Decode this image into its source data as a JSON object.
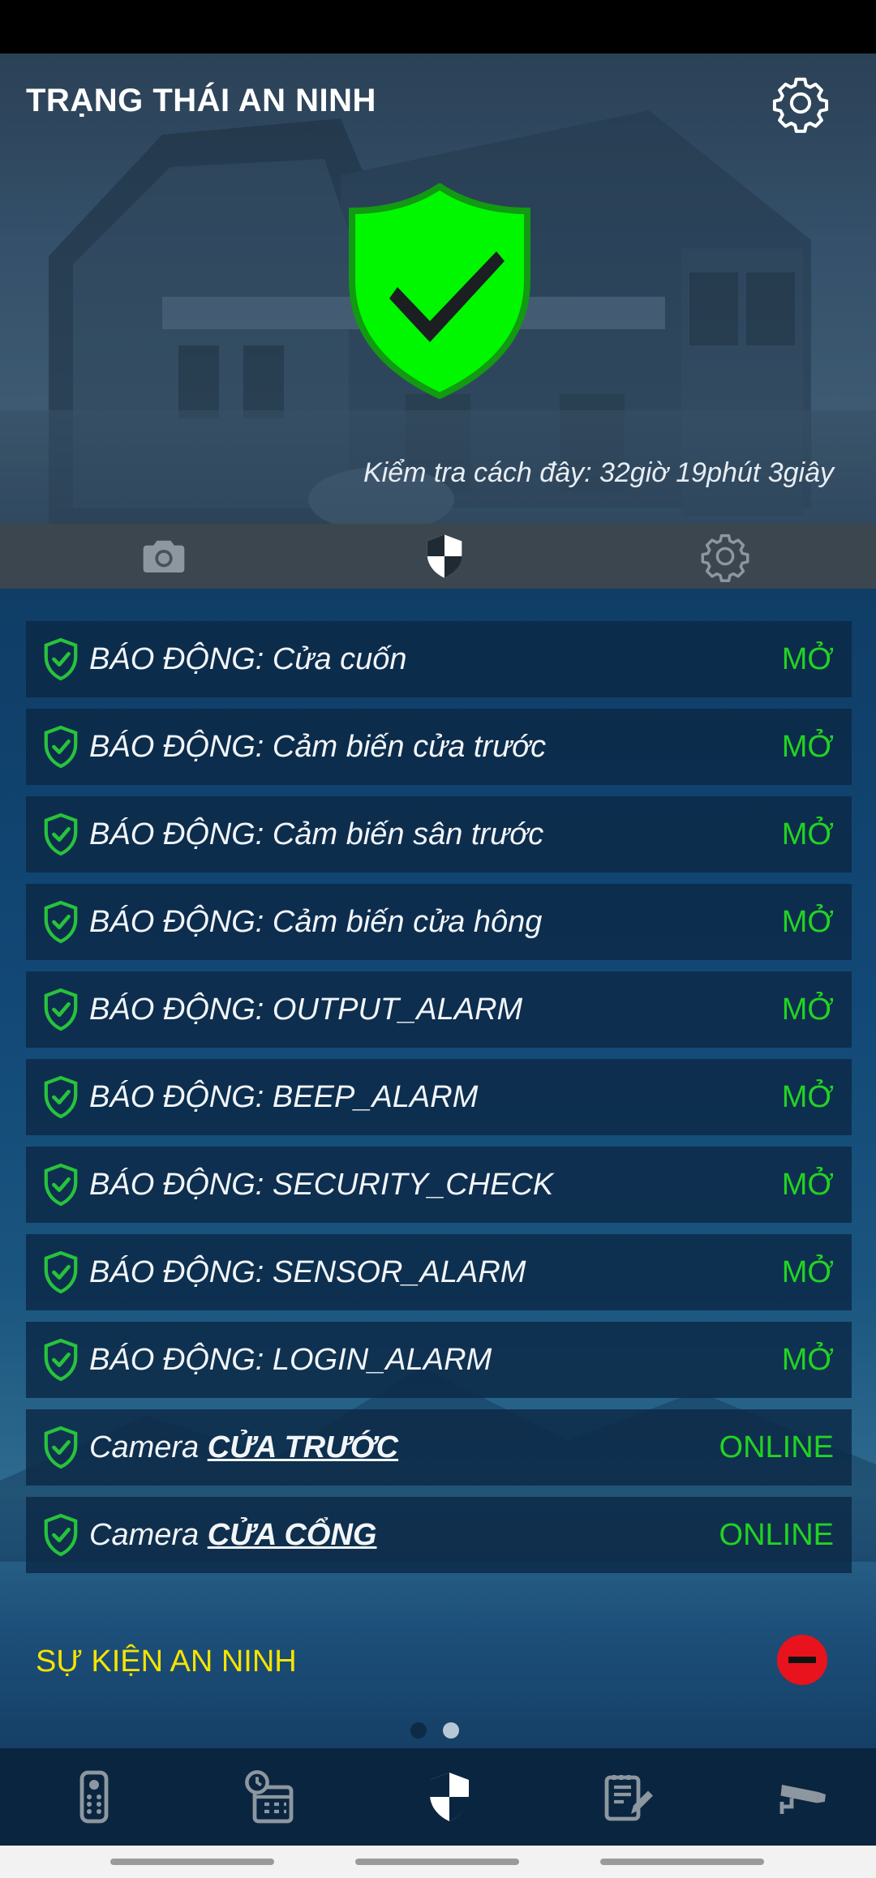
{
  "header": {
    "title": "TRẠNG THÁI AN NINH",
    "last_check": "Kiểm tra cách đây: 32giờ 19phút 3giây"
  },
  "tabs": [
    {
      "icon": "camera-icon"
    },
    {
      "icon": "shield-icon",
      "active": true
    },
    {
      "icon": "gear-icon"
    }
  ],
  "alarms": [
    {
      "label": "BÁO ĐỘNG: Cửa cuốn",
      "status": "MỞ"
    },
    {
      "label": "BÁO ĐỘNG: Cảm biến cửa trước",
      "status": "MỞ"
    },
    {
      "label": "BÁO ĐỘNG: Cảm biến sân trước",
      "status": "MỞ"
    },
    {
      "label": "BÁO ĐỘNG: Cảm biến cửa hông",
      "status": "MỞ"
    },
    {
      "label": "BÁO ĐỘNG: OUTPUT_ALARM",
      "status": "MỞ"
    },
    {
      "label": "BÁO ĐỘNG: BEEP_ALARM",
      "status": "MỞ"
    },
    {
      "label": "BÁO ĐỘNG: SECURITY_CHECK",
      "status": "MỞ"
    },
    {
      "label": "BÁO ĐỘNG: SENSOR_ALARM",
      "status": "MỞ"
    },
    {
      "label": "BÁO ĐỘNG: LOGIN_ALARM",
      "status": "MỞ"
    }
  ],
  "cameras": [
    {
      "prefix": "Camera",
      "name": "CỬA TRƯỚC",
      "status": "ONLINE"
    },
    {
      "prefix": "Camera",
      "name": "CỬA CỔNG",
      "status": "ONLINE"
    }
  ],
  "events": {
    "label": "SỰ KIỆN AN NINH"
  },
  "pager": {
    "pages": 2,
    "current": 2
  },
  "bottom_nav": [
    {
      "icon": "remote-control-icon"
    },
    {
      "icon": "schedule-calendar-icon"
    },
    {
      "icon": "security-shield-icon",
      "active": true
    },
    {
      "icon": "notes-edit-icon"
    },
    {
      "icon": "cctv-camera-icon"
    }
  ],
  "colors": {
    "status_ok": "#22d322",
    "events_label": "#f5e300",
    "shield_green": "#00f700",
    "remove_button": "#e8131c"
  }
}
